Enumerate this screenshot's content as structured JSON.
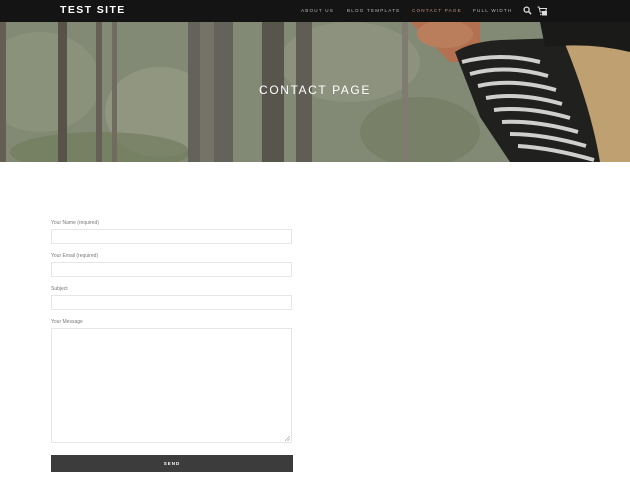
{
  "header": {
    "site_title": "TEST SITE",
    "nav": [
      {
        "label": "ABOUT US"
      },
      {
        "label": "BLOG TEMPLATE"
      },
      {
        "label": "CONTACT PAGE",
        "active": true
      },
      {
        "label": "FULL WIDTH"
      }
    ],
    "accent_color": "#c9967f"
  },
  "hero": {
    "title": "CONTACT PAGE"
  },
  "form": {
    "name_label": "Your Name (required)",
    "email_label": "Your Email (required)",
    "subject_label": "Subject",
    "message_label": "Your Message",
    "name_value": "",
    "email_value": "",
    "subject_value": "",
    "message_value": "",
    "send_label": "SEND"
  }
}
